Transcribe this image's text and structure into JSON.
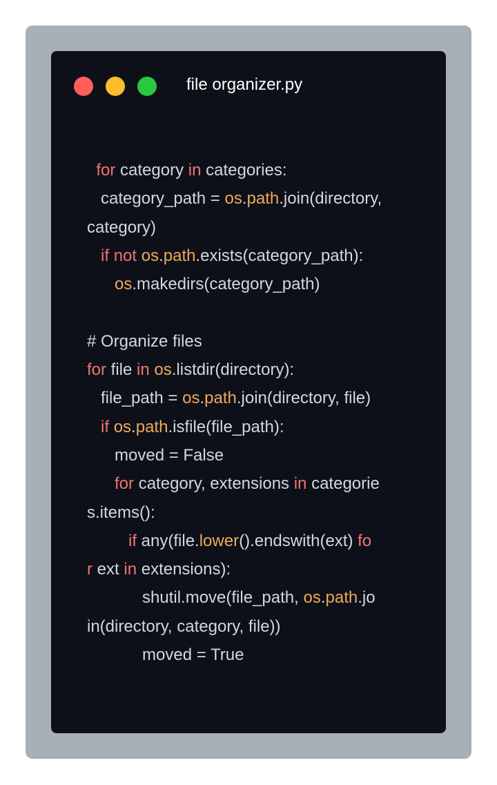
{
  "window": {
    "title": "file organizer.py",
    "colors": {
      "background": "#0d1019",
      "frame": "#a5b0b8",
      "close": "#ff5f5a",
      "minimize": "#febc2e",
      "maximize": "#28c840",
      "text": "#d4d7de",
      "keyword": "#f47272",
      "module": "#f0a955"
    }
  },
  "code": {
    "lines": [
      [
        {
          "t": "  "
        },
        {
          "t": "for",
          "k": "kw"
        },
        {
          "t": " category "
        },
        {
          "t": "in",
          "k": "kw"
        },
        {
          "t": " categories:"
        }
      ],
      [
        {
          "t": "   category_path = "
        },
        {
          "t": "os",
          "k": "mod"
        },
        {
          "t": "."
        },
        {
          "t": "path",
          "k": "mod"
        },
        {
          "t": ".join(directory,"
        }
      ],
      [
        {
          "t": "category)"
        }
      ],
      [
        {
          "t": "   "
        },
        {
          "t": "if",
          "k": "kw"
        },
        {
          "t": " "
        },
        {
          "t": "not",
          "k": "kw"
        },
        {
          "t": " "
        },
        {
          "t": "os",
          "k": "mod"
        },
        {
          "t": "."
        },
        {
          "t": "path",
          "k": "mod"
        },
        {
          "t": ".exists(category_path):"
        }
      ],
      [
        {
          "t": "      "
        },
        {
          "t": "os",
          "k": "mod"
        },
        {
          "t": ".makedirs(category_path)"
        }
      ],
      [
        {
          "t": ""
        }
      ],
      [
        {
          "t": "# Organize files"
        }
      ],
      [
        {
          "t": "for",
          "k": "kw"
        },
        {
          "t": " file "
        },
        {
          "t": "in",
          "k": "kw"
        },
        {
          "t": " "
        },
        {
          "t": "os",
          "k": "mod"
        },
        {
          "t": ".listdir(directory):"
        }
      ],
      [
        {
          "t": "   file_path = "
        },
        {
          "t": "os",
          "k": "mod"
        },
        {
          "t": "."
        },
        {
          "t": "path",
          "k": "mod"
        },
        {
          "t": ".join(directory, file)"
        }
      ],
      [
        {
          "t": "   "
        },
        {
          "t": "if",
          "k": "kw"
        },
        {
          "t": " "
        },
        {
          "t": "os",
          "k": "mod"
        },
        {
          "t": "."
        },
        {
          "t": "path",
          "k": "mod"
        },
        {
          "t": ".isfile(file_path):"
        }
      ],
      [
        {
          "t": "      moved = False"
        }
      ],
      [
        {
          "t": "      "
        },
        {
          "t": "for",
          "k": "kw"
        },
        {
          "t": " category, extensions "
        },
        {
          "t": "in",
          "k": "kw"
        },
        {
          "t": " categorie"
        }
      ],
      [
        {
          "t": "s.items():"
        }
      ],
      [
        {
          "t": "         "
        },
        {
          "t": "if",
          "k": "kw"
        },
        {
          "t": " any(file."
        },
        {
          "t": "lower",
          "k": "mod"
        },
        {
          "t": "().endswith(ext) "
        },
        {
          "t": "fo",
          "k": "kw"
        }
      ],
      [
        {
          "t": "r",
          "k": "kw"
        },
        {
          "t": " ext "
        },
        {
          "t": "in",
          "k": "kw"
        },
        {
          "t": " extensions):"
        }
      ],
      [
        {
          "t": "            shutil.move(file_path, "
        },
        {
          "t": "os",
          "k": "mod"
        },
        {
          "t": "."
        },
        {
          "t": "path",
          "k": "mod"
        },
        {
          "t": ".jo"
        }
      ],
      [
        {
          "t": "in(directory, category, file))"
        }
      ],
      [
        {
          "t": "            moved = True"
        }
      ]
    ]
  }
}
